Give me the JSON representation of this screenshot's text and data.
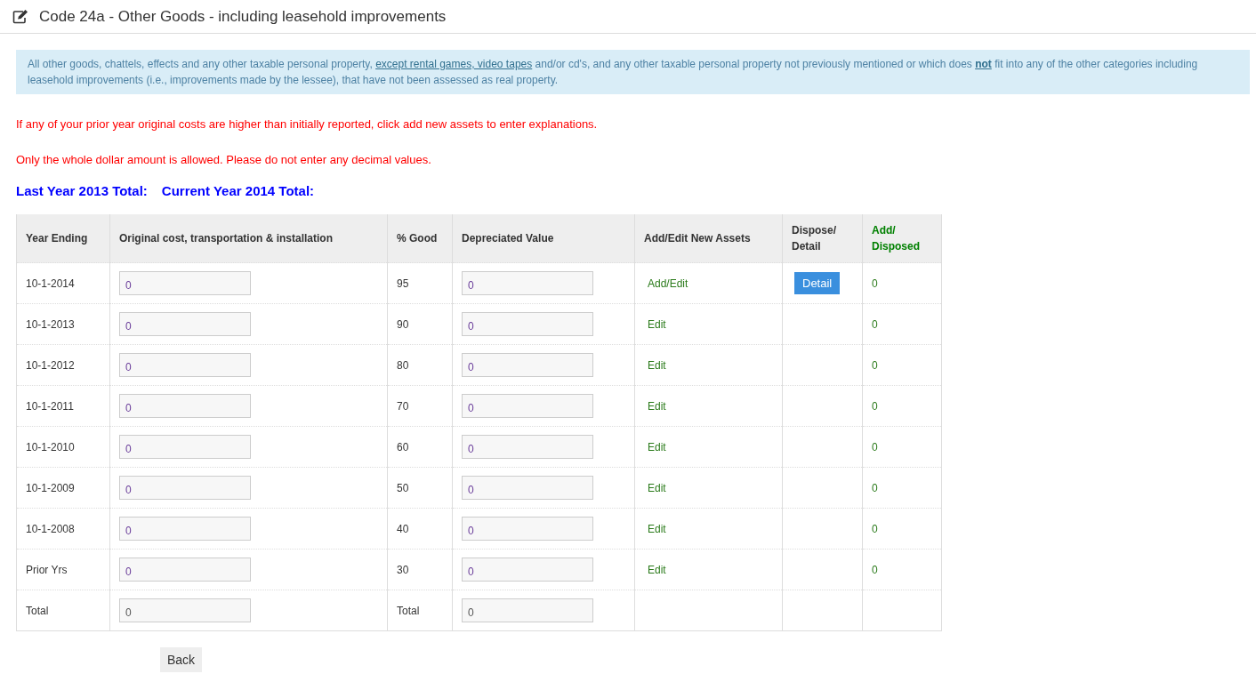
{
  "page_title": "Code 24a - Other Goods - including leasehold improvements",
  "notice": [
    {
      "kind": "text",
      "text": "All other goods, chattels, effects and any other taxable personal property, "
    },
    {
      "kind": "link",
      "text": "except rental games, video tapes"
    },
    {
      "kind": "text",
      "text": " and/or cd's, and any other taxable personal property not previously mentioned or which does "
    },
    {
      "kind": "strong_link",
      "text": "not"
    },
    {
      "kind": "text",
      "text": " fit into any of the other categories including leasehold improvements (i.e., improvements made by the lessee), that have not been assessed as real property."
    }
  ],
  "warnings": [
    "If any of your prior year original costs are higher than initially reported, click add new assets to enter explanations.",
    "Only the whole dollar amount is allowed. Please do not enter any decimal values."
  ],
  "totals": [
    "Last Year 2013 Total:",
    "Current Year 2014 Total:"
  ],
  "table": {
    "columns": [
      {
        "label": "Year Ending",
        "kind": "plain"
      },
      {
        "label": "Original cost, transportation & installation",
        "kind": "plain"
      },
      {
        "label": "% Good",
        "kind": "plain"
      },
      {
        "label": "Depreciated Value",
        "kind": "plain"
      },
      {
        "label": "Add/Edit New Assets",
        "kind": "plain"
      },
      {
        "label": "Dispose/ Detail",
        "kind": "plain"
      },
      {
        "label": "Add/ Disposed",
        "kind": "accent"
      }
    ],
    "rows": [
      {
        "kind": "year",
        "year_ending": "10-1-2014",
        "original_cost": "0",
        "good": "95",
        "depreciated": "0",
        "action": "Add/Edit",
        "detail": "Detail",
        "add_disposed": "0"
      },
      {
        "kind": "year",
        "year_ending": "10-1-2013",
        "original_cost": "0",
        "good": "90",
        "depreciated": "0",
        "action": "Edit",
        "add_disposed": "0"
      },
      {
        "kind": "year",
        "year_ending": "10-1-2012",
        "original_cost": "0",
        "good": "80",
        "depreciated": "0",
        "action": "Edit",
        "add_disposed": "0"
      },
      {
        "kind": "year",
        "year_ending": "10-1-2011",
        "original_cost": "0",
        "good": "70",
        "depreciated": "0",
        "action": "Edit",
        "add_disposed": "0"
      },
      {
        "kind": "year",
        "year_ending": "10-1-2010",
        "original_cost": "0",
        "good": "60",
        "depreciated": "0",
        "action": "Edit",
        "add_disposed": "0"
      },
      {
        "kind": "year",
        "year_ending": "10-1-2009",
        "original_cost": "0",
        "good": "50",
        "depreciated": "0",
        "action": "Edit",
        "add_disposed": "0"
      },
      {
        "kind": "year",
        "year_ending": "10-1-2008",
        "original_cost": "0",
        "good": "40",
        "depreciated": "0",
        "action": "Edit",
        "add_disposed": "0"
      },
      {
        "kind": "year",
        "year_ending": "Prior Yrs",
        "original_cost": "0",
        "good": "30",
        "depreciated": "0",
        "action": "Edit",
        "add_disposed": "0"
      },
      {
        "kind": "total",
        "year_ending": "Total",
        "original_cost": "0",
        "good": "Total",
        "depreciated": "0"
      }
    ]
  },
  "back_button": "Back"
}
